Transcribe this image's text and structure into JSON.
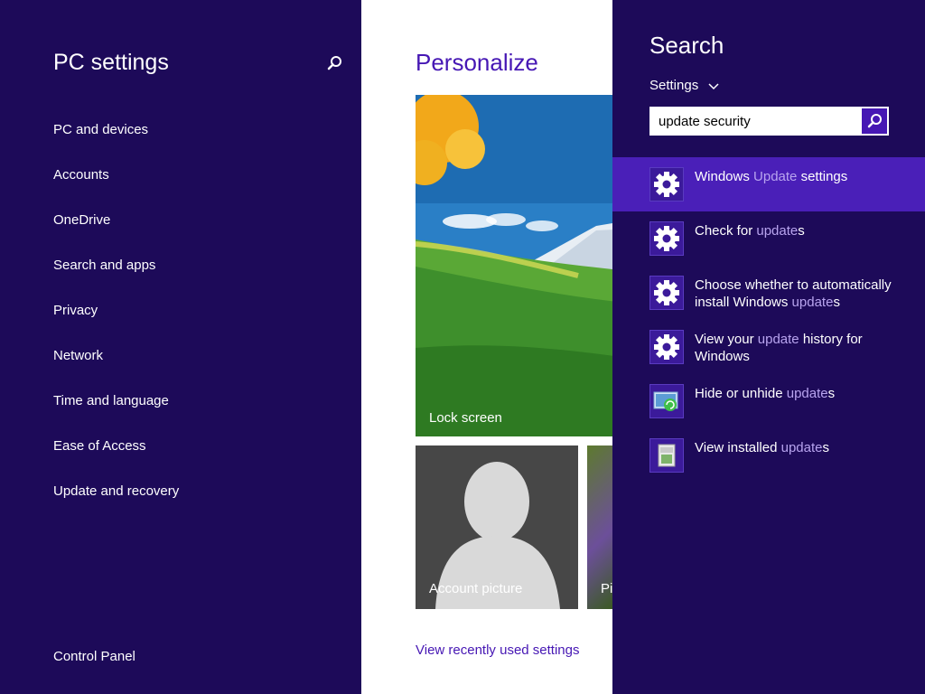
{
  "left_panel": {
    "title": "PC settings",
    "nav_items": [
      "PC and devices",
      "Accounts",
      "OneDrive",
      "Search and apps",
      "Privacy",
      "Network",
      "Time and language",
      "Ease of Access",
      "Update and recovery"
    ],
    "footer_link": "Control Panel"
  },
  "main": {
    "heading": "Personalize",
    "tiles": {
      "lock_screen": "Lock screen",
      "account_picture": "Account picture",
      "picture_password": "Pi"
    },
    "recent_link": "View recently used settings"
  },
  "search_charm": {
    "title": "Search",
    "scope": "Settings",
    "query": "update security",
    "results": [
      {
        "pre": "Windows ",
        "hl": "Update",
        "post": " settings",
        "icon": "gear-icon",
        "selected": true
      },
      {
        "pre": "Check for ",
        "hl": "update",
        "post": "s",
        "icon": "gear-icon",
        "selected": false
      },
      {
        "pre": "Choose whether to automatically install Windows ",
        "hl": "update",
        "post": "s",
        "icon": "gear-icon",
        "selected": false
      },
      {
        "pre": "View your ",
        "hl": "update",
        "post": " history for Windows",
        "icon": "gear-icon",
        "selected": false
      },
      {
        "pre": "Hide or unhide ",
        "hl": "update",
        "post": "s",
        "icon": "windows-update-icon",
        "selected": false
      },
      {
        "pre": "View installed ",
        "hl": "update",
        "post": "s",
        "icon": "installed-updates-icon",
        "selected": false
      }
    ]
  },
  "colors": {
    "panel_bg": "#1d0a59",
    "accent": "#4617b4",
    "selected_bg": "#4a1fb8",
    "highlight_text": "#b8a4ef"
  }
}
